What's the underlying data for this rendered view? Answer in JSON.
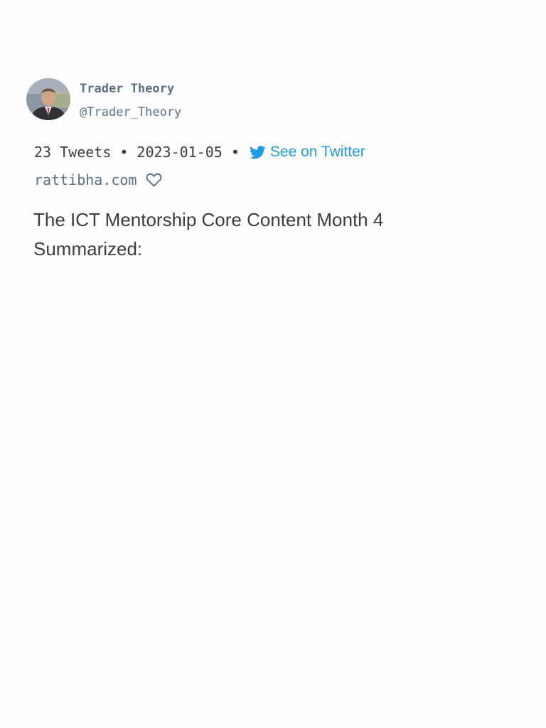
{
  "author": {
    "name": "Trader Theory",
    "handle": "@Trader_Theory"
  },
  "meta": {
    "tweet_count": "23 Tweets",
    "separator": "•",
    "date": "2023-01-05",
    "twitter_link_label": "See on Twitter",
    "twitter_icon": "twitter-bird-icon"
  },
  "source": {
    "site": "rattibha.com",
    "favorite_icon": "heart-outline-icon"
  },
  "thread": {
    "title": "The ICT Mentorship Core Content Month 4 Summarized:"
  },
  "colors": {
    "link": "#1d9bf0",
    "muted": "#5b6f86",
    "text": "#3c3c3c"
  }
}
